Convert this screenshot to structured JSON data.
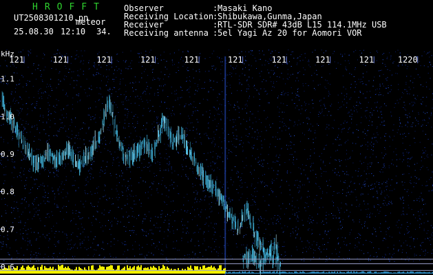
{
  "header": {
    "app_title": "HROFFT",
    "filename": "UT2508301210.pn",
    "mode": "meteor",
    "date": "25.08.30",
    "time": "12:10",
    "count": "34.",
    "info_labels": [
      "Observer",
      "Receiving Location",
      "Receiver",
      "Receiving antenna"
    ],
    "separator": ":",
    "info_values": [
      "Masaki Kano",
      "Shibukawa,Gunma,Japan",
      "RTL-SDR SDR# 43dB L15 114.1MHz USB",
      "5el Yagi Az 20 for Aomori VOR"
    ]
  },
  "colors": {
    "background": "#000000",
    "axis_text": "#ffffff",
    "app_title": "#2fd42f",
    "signal": "#48c6f2",
    "signal_bright": "#b8f0ff",
    "noise_floor": "#f2f000",
    "reference_line": "#9aa0cc"
  },
  "chart_data": {
    "type": "heatmap",
    "ylabel": "kHz",
    "x_tick_labels": [
      "121",
      "121",
      "121",
      "121",
      "121",
      "121",
      "121",
      "121",
      "121",
      "1220"
    ],
    "x_ticks": [
      1211,
      1212,
      1213,
      1214,
      1215,
      1216,
      1217,
      1218,
      1219,
      1220
    ],
    "y_ticks": [
      0.6,
      0.7,
      0.8,
      0.9,
      1.0,
      1.1
    ],
    "y_tick_labels": [
      "0.6",
      "0.7",
      "0.8",
      "0.9",
      "1.0",
      "1.1"
    ],
    "xlim": [
      1210.45,
      1220.35
    ],
    "ylim": [
      0.578,
      1.178
    ],
    "reference_lines_khz": [
      0.62,
      0.608,
      0.59
    ],
    "carrier_x": 1215.6,
    "main_trace": {
      "x": [
        1210.48,
        1210.65,
        1210.85,
        1211.1,
        1211.3,
        1211.55,
        1211.75,
        1212.0,
        1212.25,
        1212.5,
        1212.7,
        1212.85,
        1212.95,
        1213.1,
        1213.3,
        1213.55,
        1213.75,
        1213.95,
        1214.1,
        1214.2,
        1214.4,
        1214.6,
        1214.8,
        1215.0,
        1215.25,
        1215.5,
        1215.7,
        1215.9,
        1216.1,
        1216.3,
        1216.5,
        1216.7,
        1216.85
      ],
      "khz": [
        1.05,
        1.0,
        0.96,
        0.9,
        0.87,
        0.9,
        0.88,
        0.91,
        0.87,
        0.9,
        0.94,
        1.0,
        1.04,
        0.96,
        0.89,
        0.9,
        0.93,
        0.9,
        0.96,
        1.0,
        0.93,
        0.95,
        0.9,
        0.86,
        0.82,
        0.78,
        0.74,
        0.7,
        0.76,
        0.68,
        0.64,
        0.62,
        0.6
      ]
    },
    "secondary_trace": {
      "x": [
        1216.0,
        1216.2,
        1216.4,
        1216.6,
        1216.75,
        1216.85
      ],
      "khz": [
        0.62,
        0.63,
        0.6,
        0.64,
        0.66,
        0.61
      ]
    }
  }
}
